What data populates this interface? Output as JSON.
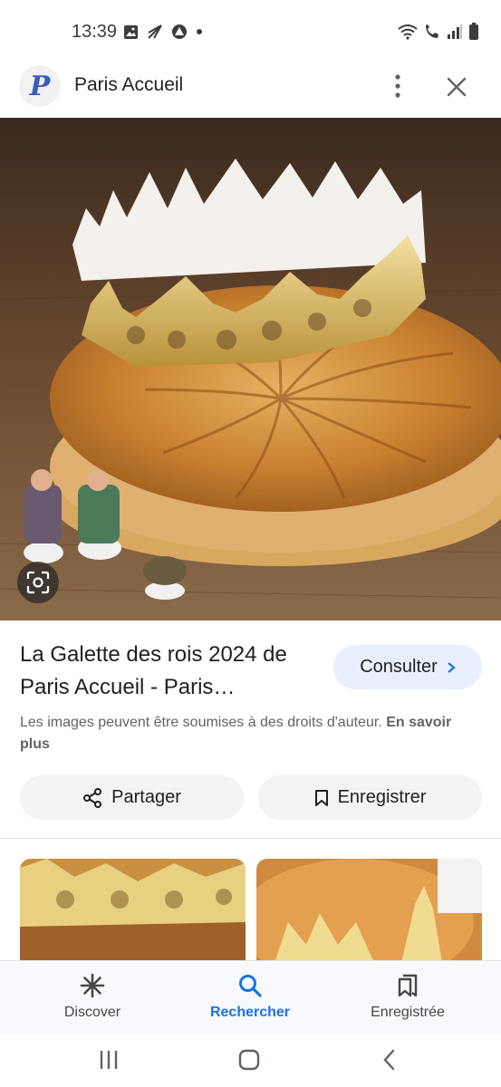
{
  "status_bar": {
    "time": "13:39",
    "left_icons": [
      "image-icon",
      "send-icon",
      "alert-icon",
      "dot-icon"
    ],
    "right_icons": [
      "wifi-icon",
      "call-icon",
      "signal-icon",
      "battery-icon"
    ]
  },
  "header": {
    "logo_letter": "P",
    "title": "Paris Accueil",
    "more_icon": "more-vert-icon",
    "close_icon": "close-icon"
  },
  "image": {
    "description_icon": "lens-icon"
  },
  "result": {
    "title": "La Galette des rois 2024 de Paris Accueil - Paris…",
    "consult_label": "Consulter",
    "copyright_text": "Les images peuvent être soumises à des droits d'auteur.",
    "learn_more": "En savoir plus",
    "share_label": "Partager",
    "save_label": "Enregistrer"
  },
  "bottom_nav": {
    "items": [
      {
        "label": "Discover",
        "icon": "asterisk-icon"
      },
      {
        "label": "Rechercher",
        "icon": "search-icon",
        "active": true
      },
      {
        "label": "Enregistrée",
        "icon": "bookmarks-icon"
      }
    ]
  },
  "colors": {
    "accent": "#1a73e8",
    "consult_bg": "#e8f0fe",
    "button_bg": "#f1f3f4"
  }
}
